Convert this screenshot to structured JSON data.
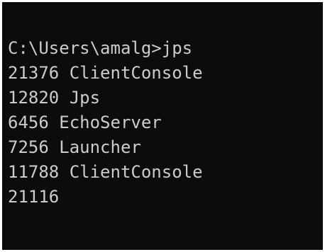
{
  "console": {
    "lines": [
      "C:\\Users\\amalg>jps",
      "21376 ClientConsole",
      "12820 Jps",
      "6456 EchoServer",
      "7256 Launcher",
      "11788 ClientConsole",
      "21116"
    ]
  }
}
